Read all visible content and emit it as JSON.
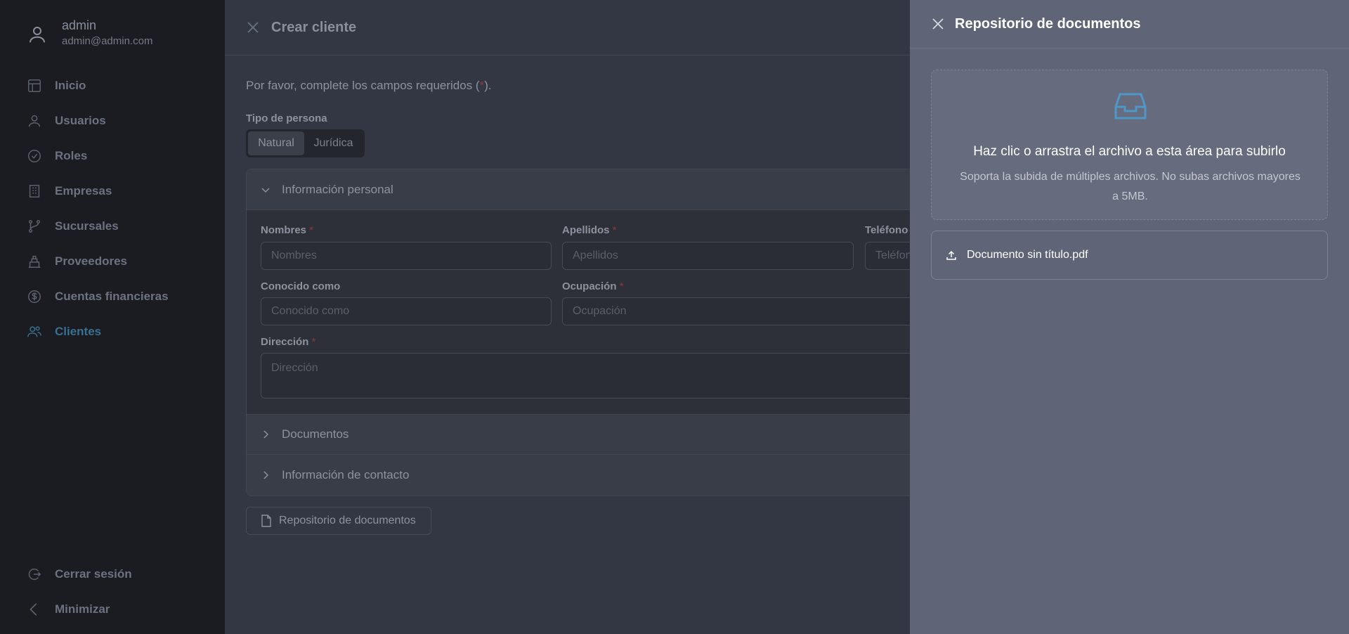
{
  "sidebar": {
    "user": {
      "name": "admin",
      "email": "admin@admin.com",
      "icon": "user-icon"
    },
    "items": [
      {
        "label": "Inicio",
        "icon": "home-icon"
      },
      {
        "label": "Usuarios",
        "icon": "user-icon"
      },
      {
        "label": "Roles",
        "icon": "check-circle-icon"
      },
      {
        "label": "Empresas",
        "icon": "building-icon"
      },
      {
        "label": "Sucursales",
        "icon": "branch-icon"
      },
      {
        "label": "Proveedores",
        "icon": "warehouse-icon"
      },
      {
        "label": "Cuentas financieras",
        "icon": "dollar-circle-icon"
      },
      {
        "label": "Clientes",
        "icon": "users-icon"
      }
    ],
    "active_item": "Clientes",
    "bottom": [
      {
        "label": "Cerrar sesión",
        "icon": "logout-icon"
      },
      {
        "label": "Minimizar",
        "icon": "chevron-left-icon"
      }
    ]
  },
  "modal": {
    "title": "Crear cliente",
    "required_note_prefix": "Por favor, complete los campos requeridos (",
    "required_note_star": "*",
    "required_note_suffix": ").",
    "person_type": {
      "label": "Tipo de persona",
      "options": [
        "Natural",
        "Jurídica"
      ],
      "selected": "Natural"
    },
    "sections": {
      "personal": "Información personal",
      "documents": "Documentos",
      "contact": "Información de contacto"
    },
    "fields": {
      "nombres": {
        "label": "Nombres",
        "placeholder": "Nombres"
      },
      "apellidos": {
        "label": "Apellidos",
        "placeholder": "Apellidos"
      },
      "telefono": {
        "label": "Teléfono",
        "placeholder": "Teléfono"
      },
      "conocido": {
        "label": "Conocido como",
        "placeholder": "Conocido como"
      },
      "ocupacion": {
        "label": "Ocupación",
        "placeholder": "Ocupación"
      },
      "direccion": {
        "label": "Dirección",
        "placeholder": "Dirección"
      }
    },
    "repo_button": "Repositorio de documentos"
  },
  "drawer": {
    "title": "Repositorio de documentos",
    "dropzone_title": "Haz clic o arrastra el archivo a esta área para subirlo",
    "dropzone_hint": "Soporta la subida de múltiples archivos. No subas archivos mayores a 5MB.",
    "files": [
      {
        "name": "Documento sin título.pdf",
        "icon": "upload-icon"
      }
    ]
  },
  "colors": {
    "sidebar_bg": "#1a1c22",
    "main_bg": "#333743",
    "drawer_bg": "#5f6477",
    "accent": "#3a6f8f",
    "inbox_icon": "#4f97c6"
  }
}
